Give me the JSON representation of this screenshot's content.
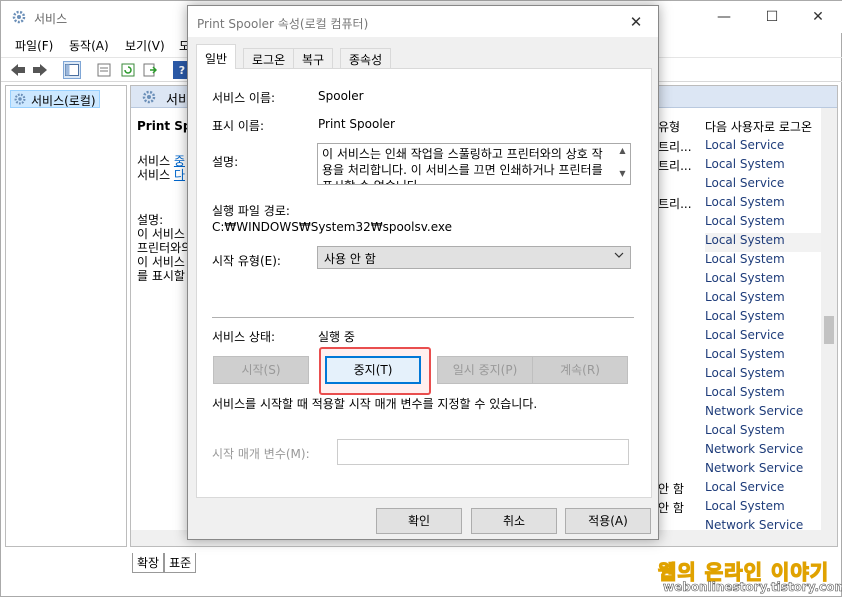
{
  "bg_window": {
    "title": "서비스",
    "menu": [
      "파일(F)",
      "동작(A)",
      "보기(V)",
      "도"
    ],
    "tree_item": "서비스(로컬)",
    "main_header": "서비",
    "detail": {
      "title": "Print Spoo",
      "line1_prefix": "서비스 ",
      "line1_link": "중",
      "line2_prefix": "서비스 ",
      "line2_link": "다",
      "desc_label": "설명:",
      "desc_lines": [
        "이 서비스",
        "프린터와의",
        "이 서비스",
        "를 표시할"
      ]
    },
    "columns": {
      "startup_type": "유형",
      "logon_as": "다음 사용자로 로그온"
    },
    "left_fragments": [
      "트리...",
      "트리...",
      "트리...",
      "안 함",
      "안 함"
    ],
    "logon_values": [
      "Local Service",
      "Local System",
      "Local Service",
      "Local System",
      "Local System",
      "Local System",
      "Local System",
      "Local System",
      "Local System",
      "Local System",
      "Local Service",
      "Local System",
      "Local System",
      "Local System",
      "Network Service",
      "Local System",
      "Network Service",
      "Network Service",
      "Local Service",
      "Local System",
      "Network Service"
    ],
    "bottom_tabs": [
      "확장",
      "표준"
    ]
  },
  "dialog": {
    "title": "Print Spooler 속성(로컬 컴퓨터)",
    "tabs": [
      "일반",
      "로그온",
      "복구",
      "종속성"
    ],
    "service_name_label": "서비스 이름:",
    "service_name": "Spooler",
    "display_name_label": "표시 이름:",
    "display_name": "Print Spooler",
    "description_label": "설명:",
    "description": "이 서비스는 인쇄 작업을 스풀링하고 프린터와의 상호 작용을 처리합니다. 이 서비스를 끄면 인쇄하거나 프린터를 표시할 수 없습니다.",
    "exe_path_label": "실행 파일 경로:",
    "exe_path": "C:₩WINDOWS₩System32₩spoolsv.exe",
    "startup_type_label": "시작 유형(E):",
    "startup_type_value": "사용 안 함",
    "status_label": "서비스 상태:",
    "status_value": "실행 중",
    "btn_start": "시작(S)",
    "btn_stop": "중지(T)",
    "btn_pause": "일시 중지(P)",
    "btn_resume": "계속(R)",
    "params_hint": "서비스를 시작할 때 적용할 시작 매개 변수를 지정할 수 있습니다.",
    "params_label": "시작 매개 변수(M):",
    "btn_ok": "확인",
    "btn_cancel": "취소",
    "btn_apply": "적용(A)"
  },
  "watermark": {
    "line1": "웹의 온라인 이야기",
    "line2": "webonlinestory.tistory.com"
  }
}
